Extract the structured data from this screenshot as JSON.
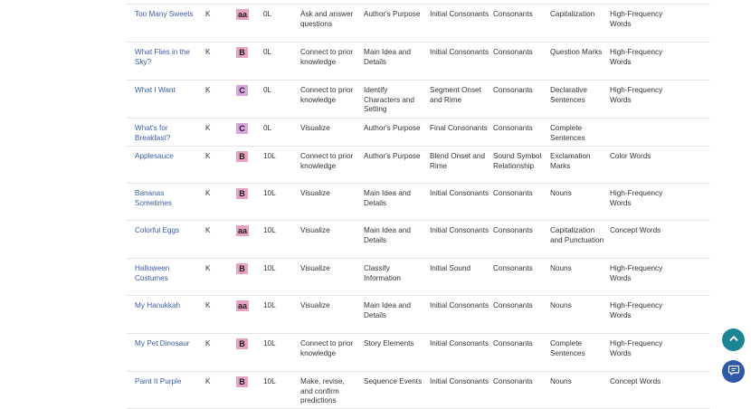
{
  "table": {
    "rows": [
      {
        "title": "Too Many Sweets",
        "grade": "K",
        "level": "aa",
        "lexile": "0L",
        "comprehension": "Ask and answer questions",
        "strategy": "Author's Purpose",
        "phonics": "Initial Consonants",
        "word_work": "Consonants",
        "grammar": "Capitalization",
        "vocabulary": "High-Frequency Words"
      },
      {
        "title": "What Flies in the Sky?",
        "grade": "K",
        "level": "B",
        "lexile": "0L",
        "comprehension": "Connect to prior knowledge",
        "strategy": "Main Idea and Details",
        "phonics": "Initial Consonants",
        "word_work": "Consonants",
        "grammar": "Question Marks",
        "vocabulary": "High-Frequency Words"
      },
      {
        "title": "What I Want",
        "grade": "K",
        "level": "C",
        "lexile": "0L",
        "comprehension": "Connect to prior knowledge",
        "strategy": "Identify Characters and Setting",
        "phonics": "Segment Onset and Rime",
        "word_work": "Consonants",
        "grammar": "Declarative Sentences",
        "vocabulary": "High-Frequency Words"
      },
      {
        "title": "What's for Breakfast?",
        "grade": "K",
        "level": "C",
        "lexile": "0L",
        "comprehension": "Visualize",
        "strategy": "Author's Purpose",
        "phonics": "Final Consonants",
        "word_work": "Consonants",
        "grammar": "Complete Sentences",
        "vocabulary": ""
      },
      {
        "title": "Applesauce",
        "grade": "K",
        "level": "B",
        "lexile": "10L",
        "comprehension": "Connect to prior knowledge",
        "strategy": "Author's Purpose",
        "phonics": "Blend Onset and Rime",
        "word_work": "Sound Symbol Relationship",
        "grammar": "Exclamation Marks",
        "vocabulary": "Color Words"
      },
      {
        "title": "Bananas Sometimes",
        "grade": "K",
        "level": "B",
        "lexile": "10L",
        "comprehension": "Visualize",
        "strategy": "Main Idea and Details",
        "phonics": "Initial Consonants",
        "word_work": "Consonants",
        "grammar": "Nouns",
        "vocabulary": "High-Frequency Words"
      },
      {
        "title": "Colorful Eggs",
        "grade": "K",
        "level": "aa",
        "lexile": "10L",
        "comprehension": "Visualize",
        "strategy": "Main Idea and Details",
        "phonics": "Initial Consonants",
        "word_work": "Consonants",
        "grammar": "Capitalization and Punctuation",
        "vocabulary": "Concept Words"
      },
      {
        "title": "Halloween Costumes",
        "grade": "K",
        "level": "B",
        "lexile": "10L",
        "comprehension": "Visualize",
        "strategy": "Classify Information",
        "phonics": "Initial Sound",
        "word_work": "Consonants",
        "grammar": "Nouns",
        "vocabulary": "High-Frequency Words"
      },
      {
        "title": "My Hanukkah",
        "grade": "K",
        "level": "aa",
        "lexile": "10L",
        "comprehension": "Visualize",
        "strategy": "Main Idea and Details",
        "phonics": "Initial Consonants",
        "word_work": "Consonants",
        "grammar": "Nouns",
        "vocabulary": "High-Frequency Words"
      },
      {
        "title": "My Pet Dinosaur",
        "grade": "K",
        "level": "B",
        "lexile": "10L",
        "comprehension": "Connect to prior knowledge",
        "strategy": "Story Elements",
        "phonics": "Initial Consonants",
        "word_work": "Consonants",
        "grammar": "Complete Sentences",
        "vocabulary": "High-Frequency Words"
      },
      {
        "title": "Paint It Purple",
        "grade": "K",
        "level": "B",
        "lexile": "10L",
        "comprehension": "Make, revise, and confirm predictions",
        "strategy": "Sequence Events",
        "phonics": "Initial Consonants",
        "word_work": "Consonants",
        "grammar": "Nouns",
        "vocabulary": "Concept Words"
      }
    ]
  },
  "buttons": {
    "scroll_top_icon": "chevron-up-icon",
    "chat_icon": "chat-icon"
  },
  "colors": {
    "link": "#3b5ba5",
    "badge_aa_b": "#e7a3c3",
    "badge_c": "#d9a6df",
    "scroll_top_bg": "#1b8594",
    "chat_bg": "#2f5aa8"
  }
}
